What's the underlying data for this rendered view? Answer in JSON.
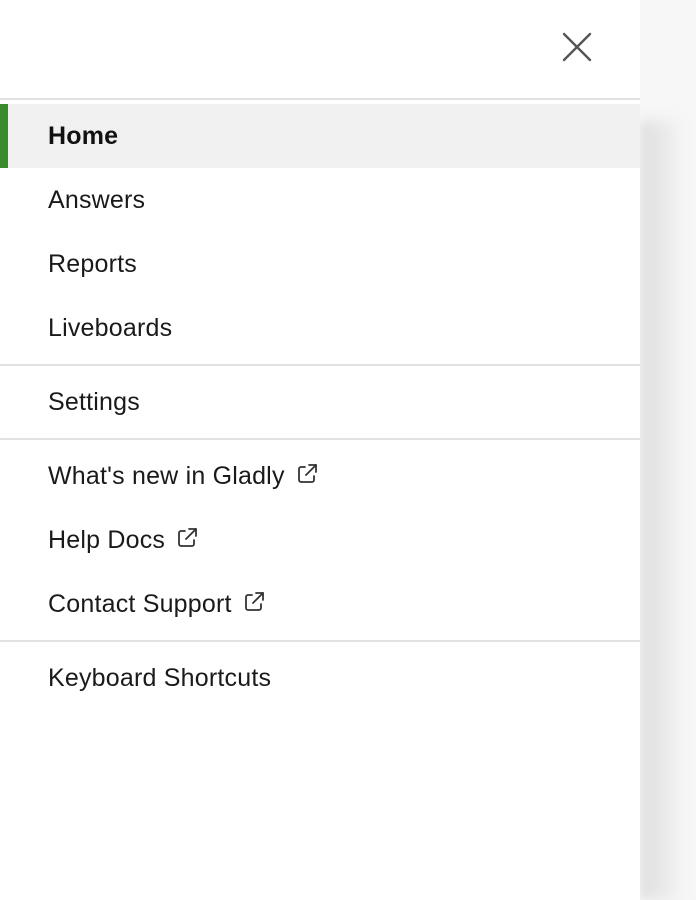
{
  "menu": {
    "close_label": "close",
    "items": [
      {
        "label": "Home",
        "active": true
      },
      {
        "label": "Answers"
      },
      {
        "label": "Reports"
      },
      {
        "label": "Liveboards"
      }
    ],
    "settings_label": "Settings",
    "external_links": [
      {
        "label": "What's new in Gladly",
        "icon": "external-link-icon"
      },
      {
        "label": "Help Docs",
        "icon": "external-link-icon"
      },
      {
        "label": "Contact Support",
        "icon": "external-link-icon"
      }
    ],
    "keyboard_shortcuts_label": "Keyboard Shortcuts"
  },
  "colors": {
    "active_indicator": "#3c8a2e",
    "active_background": "#f0f0f0",
    "divider": "#e2e2e2",
    "text": "#1a1a1a"
  }
}
